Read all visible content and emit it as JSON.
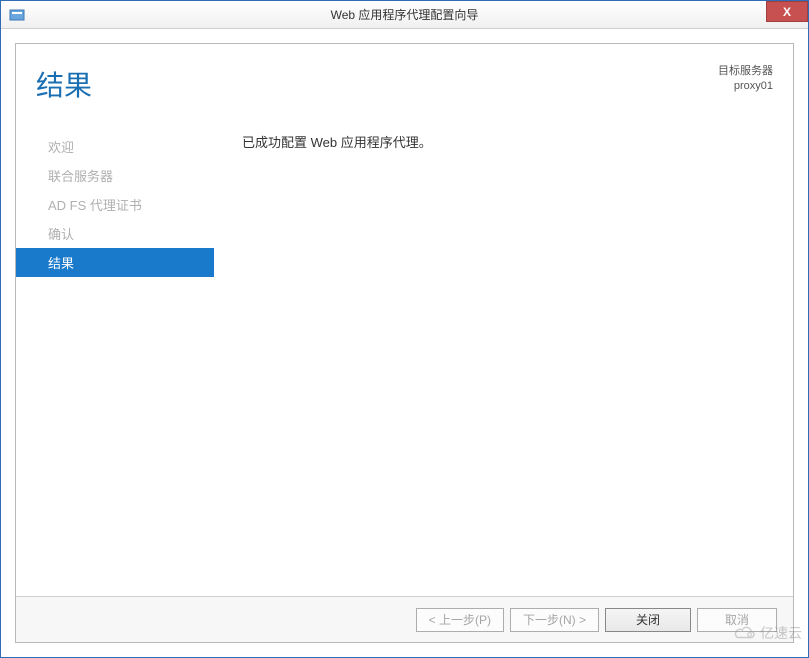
{
  "titlebar": {
    "title": "Web 应用程序代理配置向导",
    "close": "X"
  },
  "header": {
    "page_title": "结果",
    "target_label": "目标服务器",
    "target_name": "proxy01"
  },
  "sidebar": {
    "items": [
      {
        "label": "欢迎"
      },
      {
        "label": "联合服务器"
      },
      {
        "label": "AD FS 代理证书"
      },
      {
        "label": "确认"
      },
      {
        "label": "结果"
      }
    ]
  },
  "main": {
    "message": "已成功配置 Web 应用程序代理。"
  },
  "buttons": {
    "previous": "< 上一步(P)",
    "next": "下一步(N) >",
    "close": "关闭",
    "cancel": "取消"
  },
  "watermark": {
    "text": "亿速云"
  }
}
